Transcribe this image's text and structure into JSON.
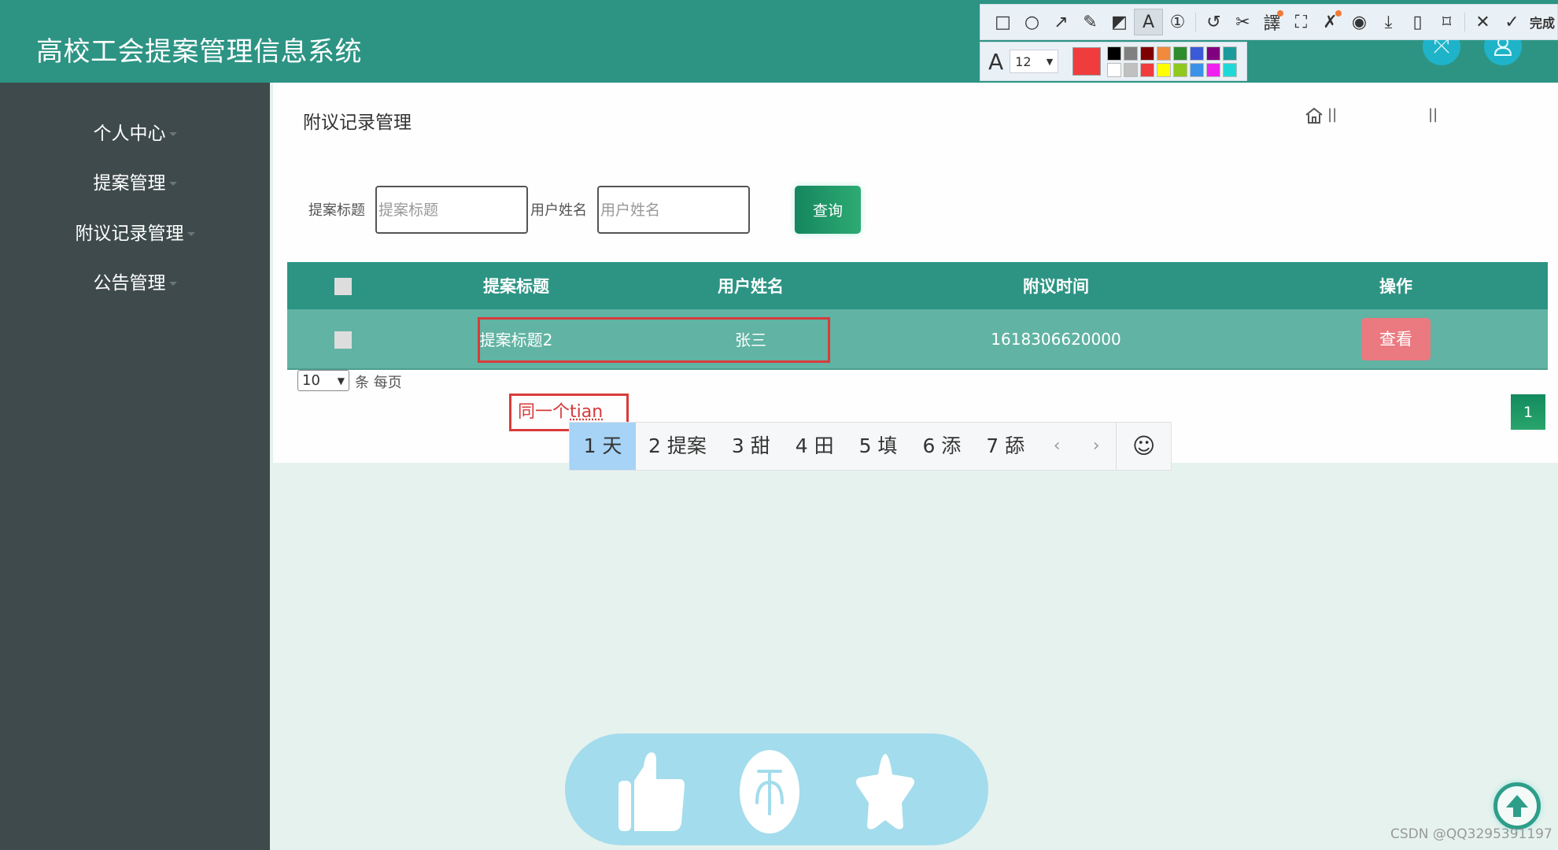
{
  "header": {
    "app_title": "高校工会提案管理信息系统",
    "fullscreen_icon": "expand-arrows-icon",
    "user_icon": "user-icon"
  },
  "sidebar": {
    "items": [
      {
        "label": "个人中心"
      },
      {
        "label": "提案管理"
      },
      {
        "label": "附议记录管理"
      },
      {
        "label": "公告管理"
      }
    ]
  },
  "main": {
    "page_title": "附议记录管理",
    "breadcrumb": {
      "sep1": "||",
      "sep2": "||"
    },
    "search": {
      "title_label": "提案标题",
      "title_placeholder": "提案标题",
      "title_value": "",
      "user_label": "用户姓名",
      "user_placeholder": "用户姓名",
      "user_value": "",
      "query_button": "查询"
    },
    "table": {
      "headers": [
        "",
        "提案标题",
        "用户姓名",
        "附议时间",
        "操作"
      ],
      "rows": [
        {
          "title": "提案标题2",
          "user": "张三",
          "time": "1618306620000",
          "action": "查看"
        }
      ]
    },
    "pagination": {
      "page_size": "10",
      "per_page_label": "条 每页",
      "current_page": "1"
    }
  },
  "ime": {
    "composing_prefix": "同一个",
    "composing_pinyin": "tian",
    "candidates": [
      "1 天",
      "2 提案",
      "3 甜",
      "4 田",
      "5 填",
      "6 添",
      "7 舔"
    ],
    "prev": "‹",
    "next": "›",
    "emoji": "☺"
  },
  "screenshot_toolbar": {
    "tools": [
      "rectangle",
      "ellipse",
      "arrow",
      "pencil",
      "mosaic",
      "text",
      "number",
      "undo",
      "cut",
      "translate",
      "ocr",
      "pin",
      "record",
      "save",
      "long-screenshot",
      "bookmark",
      "close",
      "done"
    ],
    "done_label": "完成",
    "font_size": "12",
    "current_color": "#f03c3c",
    "palette": [
      "#000000",
      "#808080",
      "#800000",
      "#f08a3c",
      "#2e8b2e",
      "#3a5ad8",
      "#800080",
      "#1a9a9a",
      "#ffffff",
      "#c0c0c0",
      "#f03c3c",
      "#ffff00",
      "#90c81e",
      "#3a92e8",
      "#f020f0",
      "#20d8d8"
    ]
  },
  "floating_bar": {
    "icons": [
      "thumbs-up-icon",
      "coin-icon",
      "star-icon"
    ]
  },
  "watermark": "CSDN @QQ3295391197",
  "colors": {
    "header": "#2d9484",
    "sidebar": "#3e4a4b",
    "table_row": "#61b3a3",
    "view_button": "#ea7a80",
    "highlight": "#d93b3b"
  }
}
